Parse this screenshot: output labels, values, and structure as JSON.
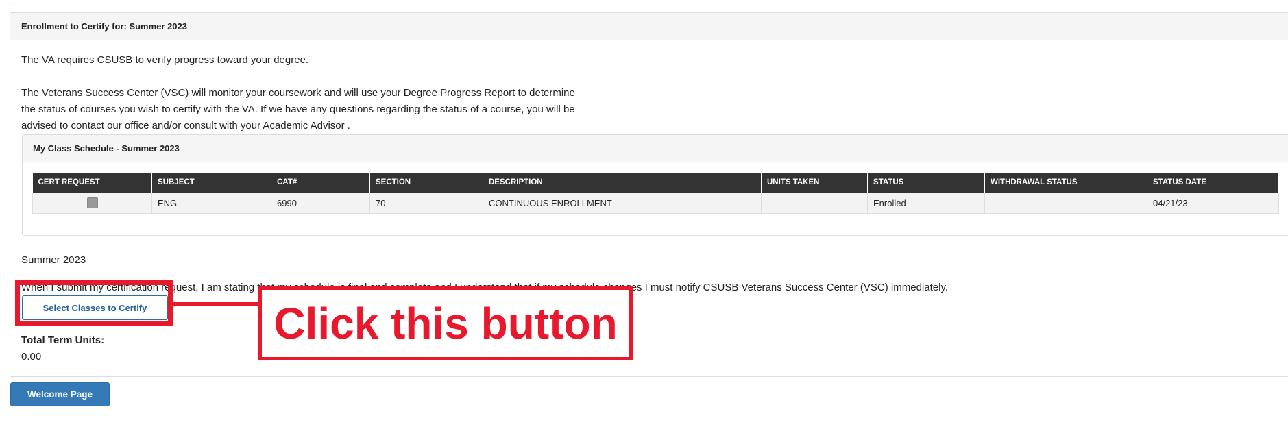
{
  "enrollment_panel": {
    "heading": "Enrollment to Certify for: Summer 2023",
    "intro_line1": "The VA requires CSUSB to verify progress toward your degree.",
    "intro_line2": "The Veterans Success Center (VSC) will monitor your coursework and will use your Degree Progress Report to determine the status of courses you wish to certify with the VA. If we have any questions regarding the status of a course, you will be advised to contact our office and/or consult with your Academic Advisor ."
  },
  "schedule": {
    "heading": "My Class Schedule - Summer 2023",
    "columns": [
      "CERT REQUEST",
      "SUBJECT",
      "CAT#",
      "SECTION",
      "DESCRIPTION",
      "UNITS TAKEN",
      "STATUS",
      "WITHDRAWAL STATUS",
      "STATUS DATE"
    ],
    "rows": [
      {
        "cert_request": "",
        "subject": "ENG",
        "cat": "6990",
        "section": "70",
        "description": "CONTINUOUS ENROLLMENT",
        "units_taken": "",
        "status": "Enrolled",
        "withdrawal_status": "",
        "status_date": "04/21/23"
      }
    ]
  },
  "term_label": "Summer 2023",
  "certification_statement": "When I submit my certification request, I am stating that my schedule is final and complete and I understand that if my schedule changes I must notify CSUSB Veterans Success Center (VSC) immediately.",
  "select_button_label": "Select Classes to Certify",
  "total_term_units_label": "Total Term Units:",
  "total_term_units_value": "0.00",
  "welcome_button_label": "Welcome Page",
  "annotation": {
    "callout_text": "Click this button",
    "color": "#e8192c"
  },
  "colors": {
    "primary_button": "#337ab7",
    "table_header": "#333333",
    "panel_heading": "#f5f5f5"
  }
}
